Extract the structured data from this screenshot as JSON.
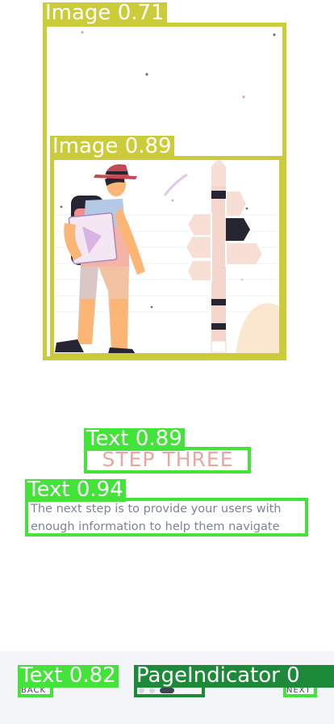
{
  "detections": {
    "image_outer_label": "Image 0.71",
    "image_inner_label": "Image 0.89",
    "title_label": "Text 0.89",
    "desc_label": "Text 0.94",
    "back_label": "Text 0.82",
    "indicator_label": "PageIndicator 0"
  },
  "onboarding": {
    "title": "STEP THREE",
    "description": "The next step is to provide your users with enough information to help them navigate"
  },
  "nav": {
    "back": "BACK",
    "next": "NEXT"
  },
  "page_indicator": {
    "count": 3,
    "active": 2
  },
  "colors": {
    "title": "#e7a7a2",
    "text": "#7e8497",
    "box_image": "#cccc3a",
    "box_text": "#44e33a",
    "box_indicator": "#1d8a3a"
  }
}
